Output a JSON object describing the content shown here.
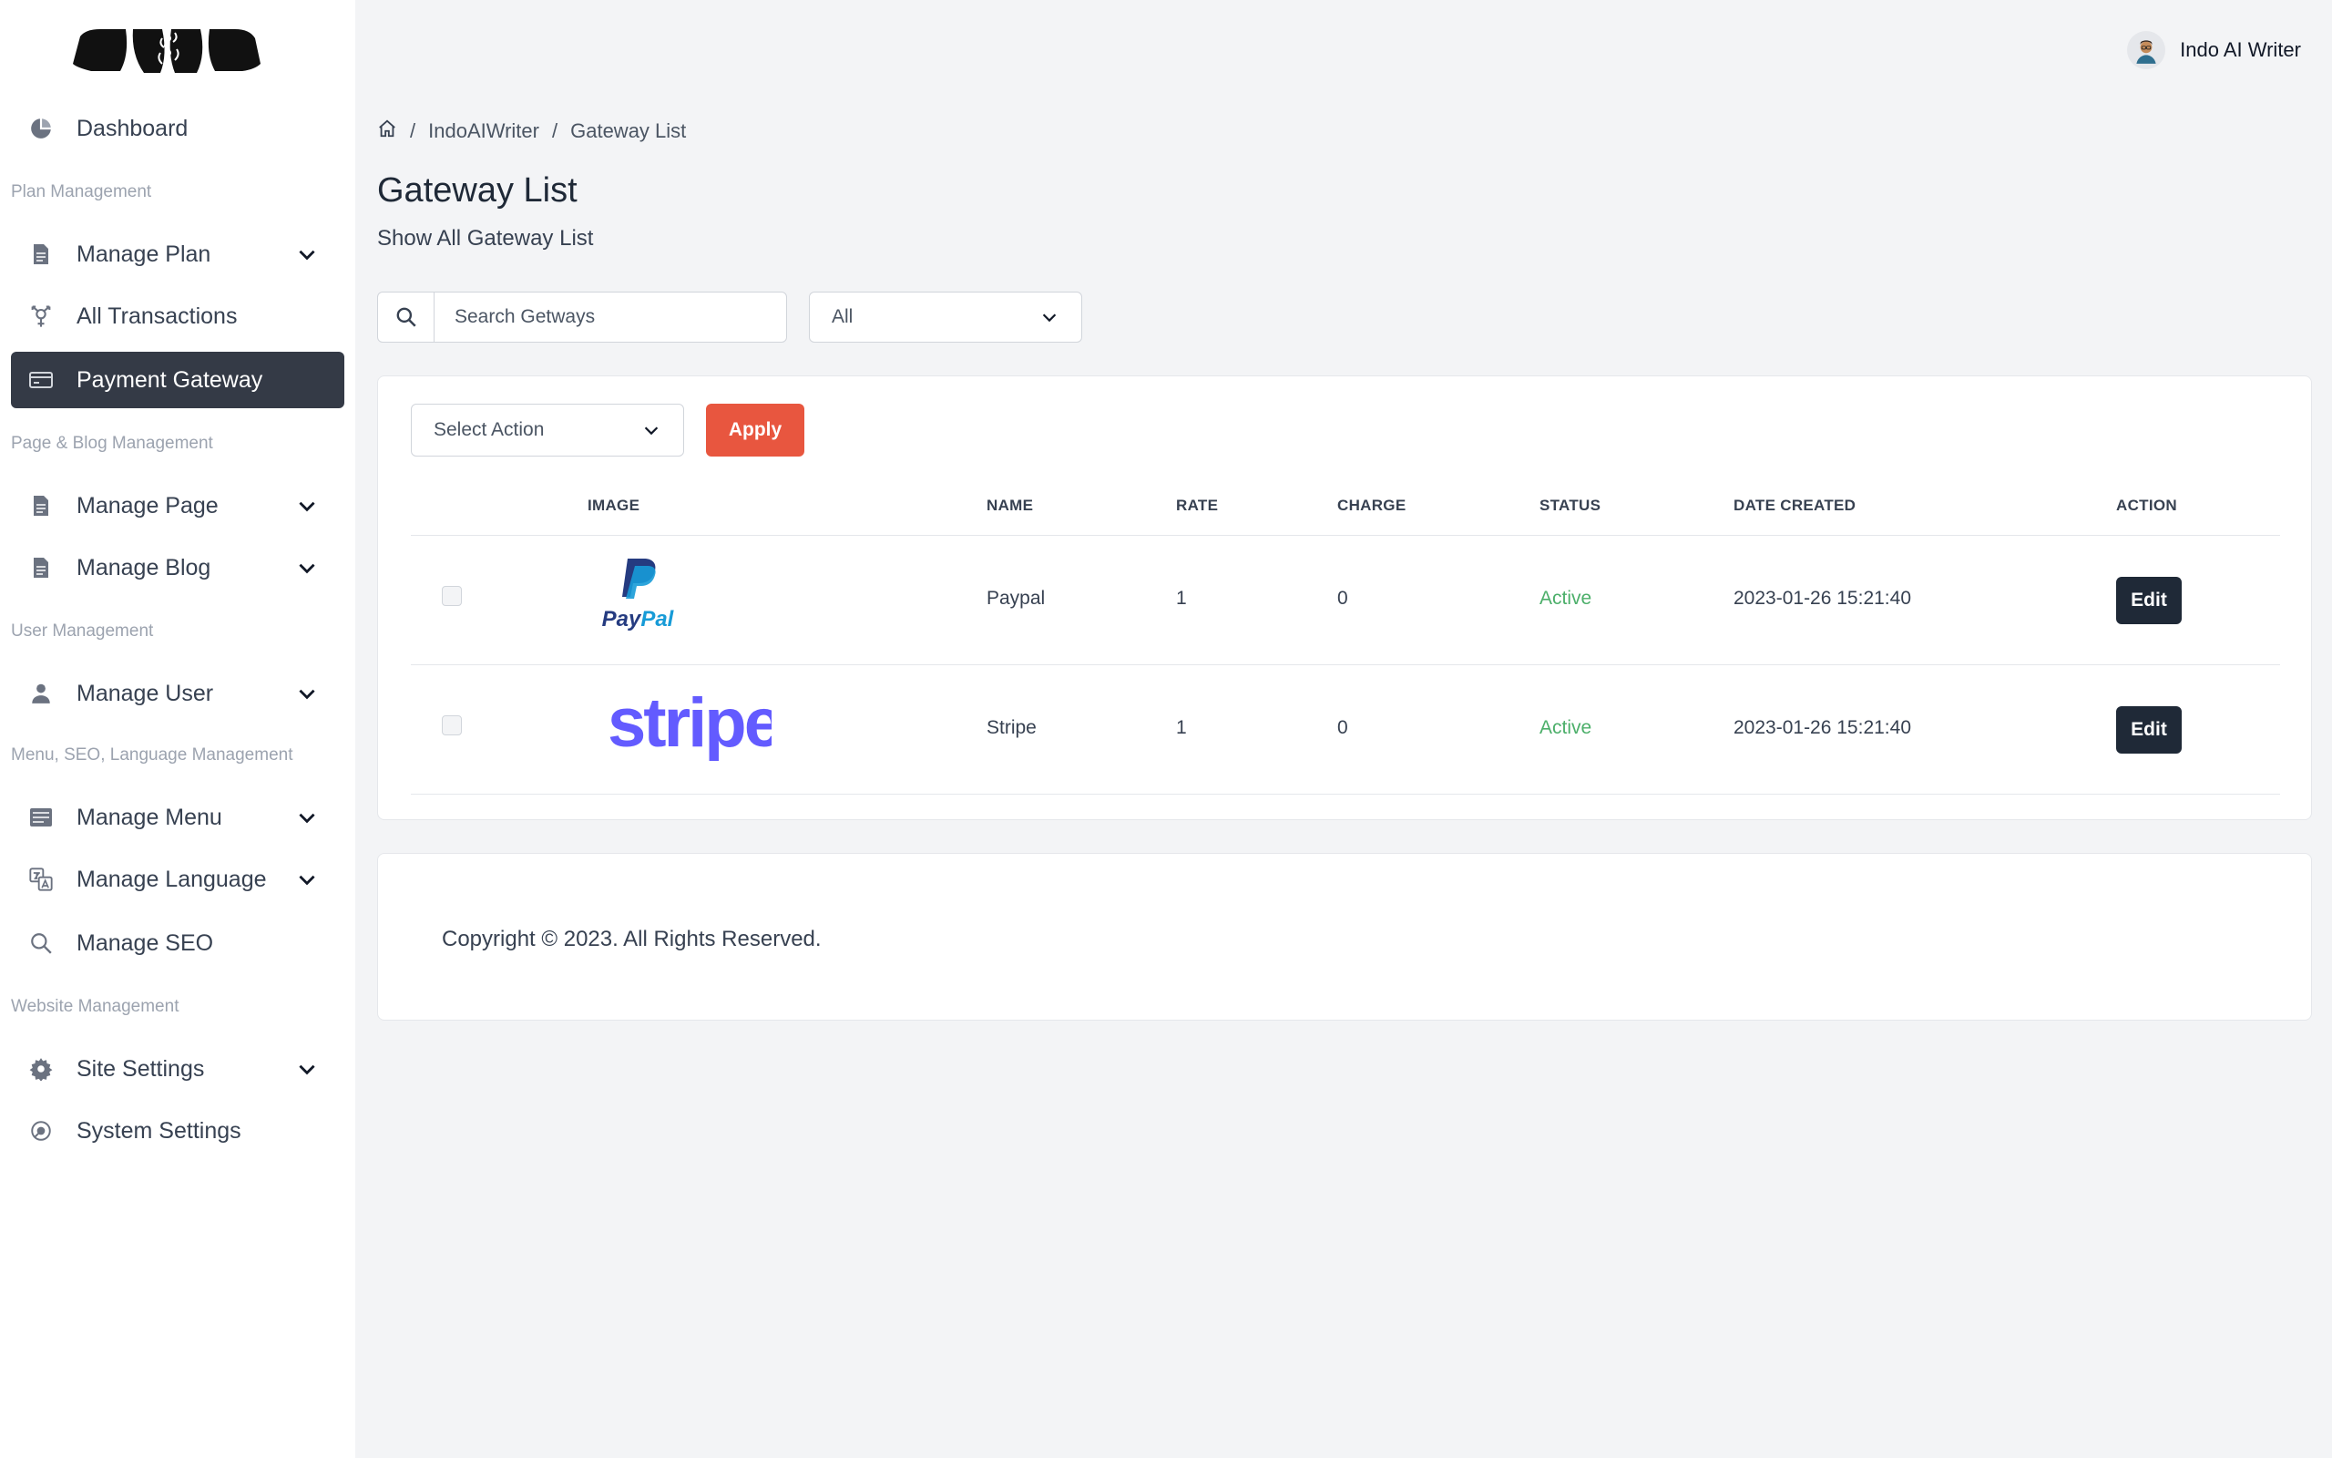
{
  "sidebar": {
    "items": {
      "dashboard": "Dashboard",
      "manage_plan": "Manage Plan",
      "all_transactions": "All Transactions",
      "payment_gateway": "Payment Gateway",
      "manage_page": "Manage Page",
      "manage_blog": "Manage Blog",
      "manage_user": "Manage User",
      "manage_menu": "Manage Menu",
      "manage_language": "Manage Language",
      "manage_seo": "Manage SEO",
      "site_settings": "Site Settings",
      "system_settings": "System Settings"
    },
    "sections": {
      "plan": "Plan Management",
      "page_blog": "Page & Blog Management",
      "user": "User Management",
      "menu_seo_lang": "Menu, SEO, Language Management",
      "website": "Website Management"
    },
    "active_item": "payment_gateway"
  },
  "header": {
    "user_name": "Indo AI Writer"
  },
  "breadcrumb": {
    "items": [
      "IndoAIWriter",
      "Gateway List"
    ],
    "separator": "/"
  },
  "page": {
    "title": "Gateway List",
    "subtitle": "Show All Gateway List"
  },
  "search": {
    "placeholder": "Search Getways",
    "value": ""
  },
  "filter": {
    "selected": "All"
  },
  "bulk": {
    "select_label": "Select Action",
    "apply_label": "Apply"
  },
  "table": {
    "headers": {
      "image": "IMAGE",
      "name": "NAME",
      "rate": "RATE",
      "charge": "CHARGE",
      "status": "STATUS",
      "date_created": "DATE CREATED",
      "action": "ACTION"
    },
    "rows": [
      {
        "logo": "paypal-logo",
        "name": "Paypal",
        "rate": "1",
        "charge": "0",
        "status": "Active",
        "date_created": "2023-01-26 15:21:40",
        "action": "Edit"
      },
      {
        "logo": "stripe-logo",
        "name": "Stripe",
        "rate": "1",
        "charge": "0",
        "status": "Active",
        "date_created": "2023-01-26 15:21:40",
        "action": "Edit"
      }
    ]
  },
  "footer": {
    "copyright": "Copyright © 2023. All Rights Reserved."
  },
  "colors": {
    "sidebar_active": "#343a46",
    "apply_button": "#e8563f",
    "status_active": "#4caf6a",
    "edit_button": "#1f2937",
    "stripe_brand": "#635bff",
    "paypal_dark": "#253b80",
    "paypal_light": "#179bd7"
  }
}
